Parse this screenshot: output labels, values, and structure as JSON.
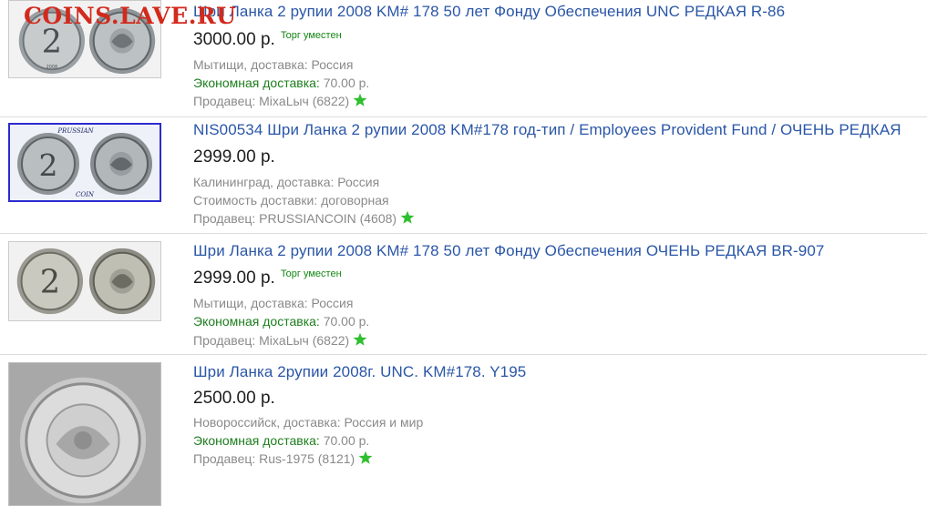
{
  "watermark": "COINS.LAVE.RU",
  "listings": [
    {
      "title": "Шри Ланка 2 рупии 2008 KM# 178 50 лет Фонду Обеспечения UNC РЕДКАЯ R-86",
      "price": "3000.00 р.",
      "haggle": "Торг уместен",
      "location": "Мытищи, доставка: Россия",
      "shipping_label": "Экономная доставка:",
      "shipping_value": "70.00 р.",
      "seller": "Продавец: МixaLыч (6822)",
      "thumb_text": "2008"
    },
    {
      "title": "NIS00534 Шри Ланка 2 рупии 2008 KM#178 год-тип / Employees Provident Fund / ОЧЕНЬ РЕДКАЯ",
      "price": "2999.00 р.",
      "haggle": "",
      "location": "Калининград, доставка: Россия",
      "shipping_label": "Стоимость доставки: договорная",
      "shipping_value": "",
      "seller": "Продавец: PRUSSIANCOIN (4608)",
      "thumb_top": "PRUSSIAN",
      "thumb_bottom": "COIN"
    },
    {
      "title": "Шри Ланка 2 рупии 2008 KM# 178 50 лет Фонду Обеспечения ОЧЕНЬ РЕДКАЯ BR-907",
      "price": "2999.00 р.",
      "haggle": "Торг уместен",
      "location": "Мытищи, доставка: Россия",
      "shipping_label": "Экономная доставка:",
      "shipping_value": "70.00 р.",
      "seller": "Продавец: МixaLыч (6822)",
      "thumb_text": "2008"
    },
    {
      "title": "Шри Ланка 2рупии 2008г. UNC. KM#178. Y195",
      "price": "2500.00 р.",
      "haggle": "",
      "location": "Новороссийск, доставка: Россия и мир",
      "shipping_label": "Экономная доставка:",
      "shipping_value": "70.00 р.",
      "seller": "Продавец: Rus-1975 (8121)"
    }
  ],
  "colors": {
    "link": "#2a56a8",
    "green": "#1d7d1d",
    "star": "#2fbf2f",
    "watermark": "#d22a1d"
  },
  "icons": {
    "rating_star": "green-star-icon"
  }
}
